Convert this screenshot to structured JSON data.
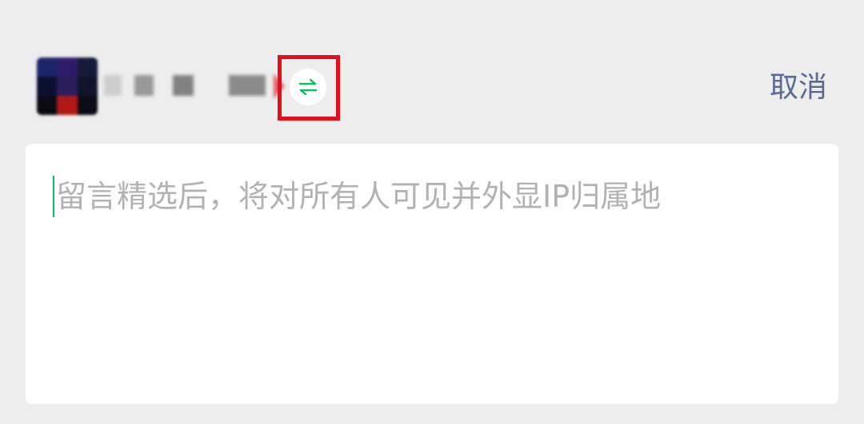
{
  "header": {
    "cancel_label": "取消",
    "switch_icon": "swap-arrows-icon",
    "accent_color": "#07c160",
    "highlight_color": "#e3101b"
  },
  "comment": {
    "placeholder": "留言精选后，将对所有人可见并外显IP归属地"
  }
}
